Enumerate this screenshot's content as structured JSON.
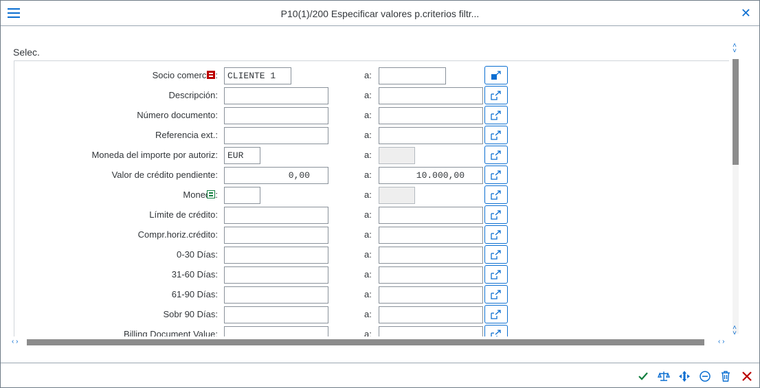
{
  "window": {
    "title": "P10(1)/200 Especificar valores p.criterios filtr...",
    "close_glyph": "✕"
  },
  "section": {
    "label": "Selec."
  },
  "separator_label": "a:",
  "rows": [
    {
      "label": "Socio comercial:",
      "from": "CLIENTE 1",
      "to": "",
      "indicator": "red"
    },
    {
      "label": "Descripción:",
      "from": "",
      "to": ""
    },
    {
      "label": "Número documento:",
      "from": "",
      "to": ""
    },
    {
      "label": "Referencia ext.:",
      "from": "",
      "to": ""
    },
    {
      "label": "Moneda del importe por autoriz:",
      "from": "EUR",
      "to": ""
    },
    {
      "label": "Valor de crédito pendiente:",
      "from": "0,00",
      "to": "10.000,00"
    },
    {
      "label": "Moneda:",
      "from": "",
      "to": "",
      "indicator": "green"
    },
    {
      "label": "Límite de crédito:",
      "from": "",
      "to": ""
    },
    {
      "label": "Compr.horiz.crédito:",
      "from": "",
      "to": ""
    },
    {
      "label": "0-30 Días:",
      "from": "",
      "to": ""
    },
    {
      "label": "31-60 Días:",
      "from": "",
      "to": ""
    },
    {
      "label": "61-90 Días:",
      "from": "",
      "to": ""
    },
    {
      "label": "Sobr 90 Días:",
      "from": "",
      "to": ""
    },
    {
      "label": "Billing Document Value:",
      "from": "",
      "to": ""
    }
  ],
  "icons": {
    "menu": "hamburger-icon",
    "close": "close-icon",
    "multiple_selection": "multiple-selection-icon",
    "footer": [
      "checkmark-icon",
      "scales-icon",
      "move-icon",
      "minus-circle-icon",
      "trash-icon",
      "cancel-icon"
    ]
  },
  "colors": {
    "accent": "#0a6ed1",
    "required": "#bb0000",
    "positive": "#107e3e",
    "negative": "#bb0000"
  }
}
